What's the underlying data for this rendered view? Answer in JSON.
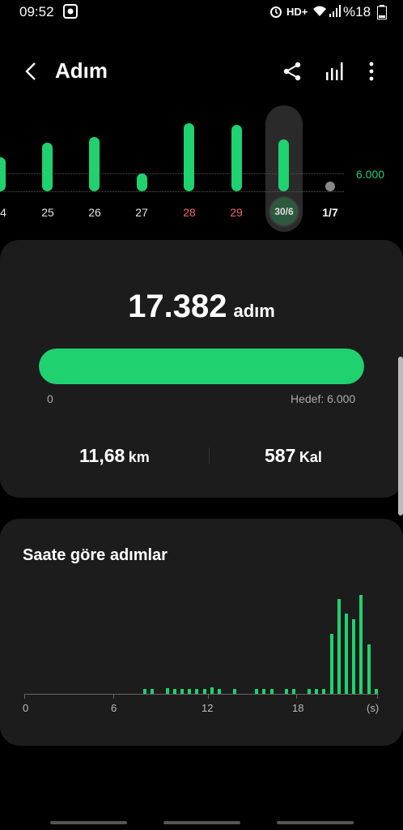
{
  "status": {
    "time": "09:52",
    "network": "HD+",
    "battery": "%18"
  },
  "header": {
    "title": "Adım",
    "icons": [
      "back-icon",
      "share-icon",
      "chart-icon",
      "more-icon"
    ]
  },
  "weekly": {
    "goal_label": "6.000",
    "days": [
      {
        "label": "4",
        "value": 3800
      },
      {
        "label": "25",
        "value": 5600
      },
      {
        "label": "26",
        "value": 6500
      },
      {
        "label": "27",
        "value": 1800
      },
      {
        "label": "28",
        "value": 8200
      },
      {
        "label": "29",
        "value": 8000
      },
      {
        "label": "30/6",
        "value": 6000
      },
      {
        "label": "1/7",
        "value": 0
      }
    ]
  },
  "summary": {
    "steps": "17.382",
    "unit": "adım",
    "progress_start": "0",
    "goal": "Hedef: 6.000",
    "progress_fraction": 1.0,
    "distance_value": "11,68",
    "distance_unit": "km",
    "calories_value": "587",
    "calories_unit": "Kal"
  },
  "hourly": {
    "title": "Saate göre adımlar",
    "axis_labels": [
      "0",
      "6",
      "12",
      "18",
      "(s)"
    ]
  },
  "colors": {
    "accent": "#1fd26f",
    "weekend": "#f2676d",
    "card": "#1c1c1c"
  }
}
